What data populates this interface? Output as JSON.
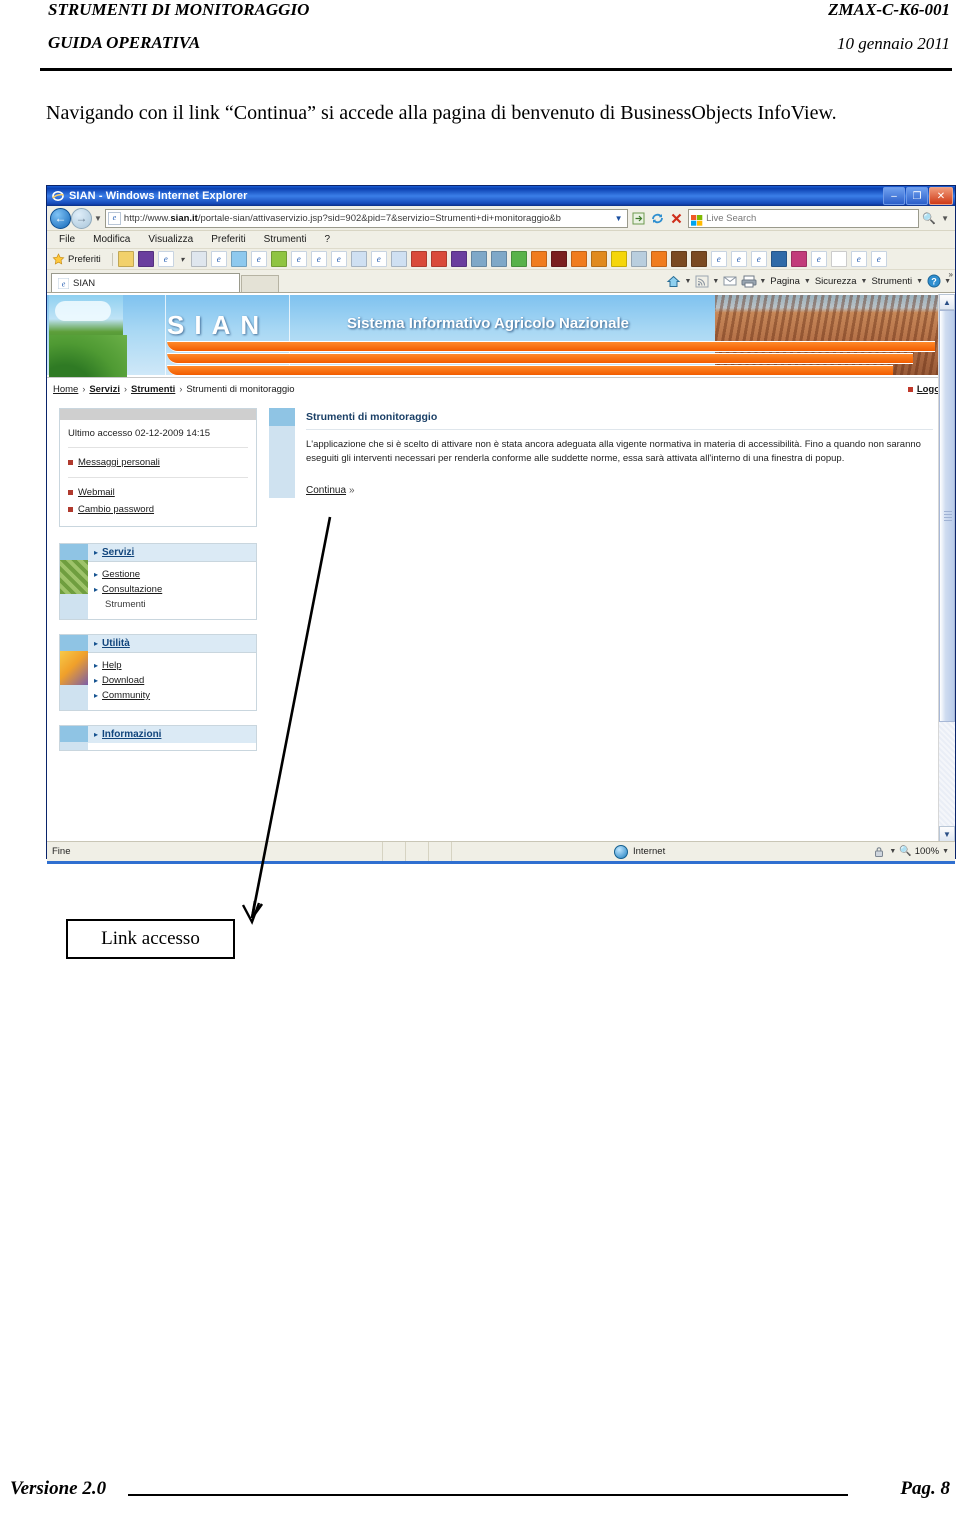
{
  "document": {
    "header": {
      "title": "STRUMENTI DI MONITORAGGIO",
      "subtitle": "GUIDA OPERATIVA",
      "code": "ZMAX-C-K6-001",
      "date": "10 gennaio 2011"
    },
    "intro_paragraph": "Navigando con il link “Continua” si accede alla pagina di benvenuto di BusinessObjects InfoView.",
    "annotation": {
      "label": "Link accesso"
    },
    "footer": {
      "version": "Versione 2.0",
      "page": "Pag. 8"
    }
  },
  "browser": {
    "window_title": "SIAN - Windows Internet Explorer",
    "window_icon": "internet-explorer-icon",
    "controls": {
      "minimize": "–",
      "restore": "❐",
      "close": "✕"
    },
    "address": {
      "url_prefix": "http://www.",
      "url_domain": "sian.it",
      "url_path": "/portale-sian/attivaservizio.jsp?sid=902&pid=7&servizio=Strumenti+di+monitoraggio&b",
      "back_label": "←",
      "forward_label": "→",
      "history_caret": "▼",
      "dropdown_caret": "▼",
      "compat_icon": "compatibility-view-icon",
      "refresh_icon": "refresh-icon",
      "stop_icon": "stop-icon"
    },
    "search": {
      "placeholder": "Live Search",
      "provider_icon": "live-search-icon",
      "go_icon": "search-icon"
    },
    "menu": [
      "File",
      "Modifica",
      "Visualizza",
      "Preferiti",
      "Strumenti",
      "?"
    ],
    "favorites": {
      "label": "Preferiti",
      "star_icon": "star-icon",
      "items": [
        {
          "icon": "star-outline-icon",
          "color": "#f2d16b"
        },
        {
          "icon": "tumblr-icon",
          "color": "#6a3e9e"
        },
        {
          "icon": "ie-page-icon",
          "color": "#ffffff"
        },
        {
          "icon": "chevron-down-icon",
          "color": "#444444"
        },
        {
          "icon": "page-icon",
          "color": "#dfe6ee"
        },
        {
          "icon": "ie-page-icon",
          "color": "#ffffff"
        },
        {
          "icon": "blue-page-icon",
          "color": "#8ec9ee"
        },
        {
          "icon": "ie-page-icon",
          "color": "#ffffff"
        },
        {
          "icon": "windows-icon",
          "color": "#8fc441"
        },
        {
          "icon": "ie-page-icon",
          "color": "#ffffff"
        },
        {
          "icon": "ie-page-icon",
          "color": "#ffffff"
        },
        {
          "icon": "ie-page-icon",
          "color": "#ffffff"
        },
        {
          "icon": "new-page-icon",
          "color": "#cfe0f2"
        },
        {
          "icon": "ie-page-icon",
          "color": "#ffffff"
        },
        {
          "icon": "new-page-icon",
          "color": "#cfe0f2"
        },
        {
          "icon": "alert-page-icon",
          "color": "#d94a3a"
        },
        {
          "icon": "alert-page-icon",
          "color": "#d94a3a"
        },
        {
          "icon": "tumblr-icon",
          "color": "#6a3e9e"
        },
        {
          "icon": "note-icon",
          "color": "#7fa8c8"
        },
        {
          "icon": "note-icon",
          "color": "#7fa8c8"
        },
        {
          "icon": "green-shape-icon",
          "color": "#58b24a"
        },
        {
          "icon": "orange-doc-icon",
          "color": "#f07c1e"
        },
        {
          "icon": "mcafee-icon",
          "color": "#7a1f1f"
        },
        {
          "icon": "orange-doc-icon",
          "color": "#f07c1e"
        },
        {
          "icon": "warning-icon",
          "color": "#e08a1e"
        },
        {
          "icon": "smiley-icon",
          "color": "#f5d60a"
        },
        {
          "icon": "arrow-icon",
          "color": "#b9cede"
        },
        {
          "icon": "orange-doc-icon",
          "color": "#f07c1e"
        },
        {
          "icon": "monkey-icon",
          "color": "#7a4a22"
        },
        {
          "icon": "monkey-icon",
          "color": "#7a4a22"
        },
        {
          "icon": "ie-page-icon",
          "color": "#ffffff"
        },
        {
          "icon": "ie-page-icon",
          "color": "#ffffff"
        },
        {
          "icon": "ie-page-icon",
          "color": "#ffffff"
        },
        {
          "icon": "globe-app-icon",
          "color": "#2f6aa8"
        },
        {
          "icon": "qr-icon",
          "color": "#c23b7a"
        },
        {
          "icon": "ie-page-icon",
          "color": "#ffffff"
        },
        {
          "icon": "letter-a-icon",
          "color": "#ffffff"
        },
        {
          "icon": "ie-page-icon",
          "color": "#ffffff"
        },
        {
          "icon": "ie-page-icon",
          "color": "#ffffff"
        }
      ]
    },
    "tab": {
      "title": "SIAN",
      "icon": "ie-page-icon"
    },
    "command_bar": {
      "home_icon": "home-icon",
      "feeds_icon": "rss-icon",
      "read_mail_icon": "mail-icon",
      "print_icon": "printer-icon",
      "items": [
        "Pagina",
        "Sicurezza",
        "Strumenti"
      ],
      "help_icon": "help-icon",
      "overflow": "»"
    },
    "status_bar": {
      "status_text": "Fine",
      "zone": "Internet",
      "zone_icon": "globe-icon",
      "protected_icon": "lock-icon",
      "zoom": "100%",
      "zoom_icon": "magnifier-icon"
    },
    "scrollbar": {
      "up_arrow": "▲",
      "down_arrow": "▼"
    }
  },
  "page": {
    "banner": {
      "logo": "SIAN",
      "tagline": "Sistema Informativo Agricolo Nazionale",
      "colors": {
        "orange": "#f25c00",
        "sky": "#7fc2ef",
        "field": "#b3724a"
      }
    },
    "breadcrumb": {
      "items": [
        {
          "label": "Home",
          "bold": false
        },
        {
          "label": "Servizi",
          "bold": true
        },
        {
          "label": "Strumenti",
          "bold": true
        }
      ],
      "current": "Strumenti di monitoraggio",
      "separator": "›",
      "logout": "Logout"
    },
    "sidebar": {
      "last_access": "Ultimo accesso 02-12-2009 14:15",
      "links": [
        "Messaggi personali",
        "Webmail",
        "Cambio password"
      ],
      "panels": [
        {
          "title": "Servizi",
          "art": "field-texture",
          "items": [
            {
              "label": "Gestione",
              "link": true
            },
            {
              "label": "Consultazione",
              "link": true
            },
            {
              "label": "Strumenti",
              "link": false
            }
          ]
        },
        {
          "title": "Utilità",
          "art": "tools-texture",
          "items": [
            {
              "label": "Help",
              "link": true
            },
            {
              "label": "Download",
              "link": true
            },
            {
              "label": "Community",
              "link": true
            }
          ]
        },
        {
          "title": "Informazioni",
          "art": "none",
          "items": []
        }
      ]
    },
    "content": {
      "title": "Strumenti di monitoraggio",
      "paragraph": "L'applicazione che si è scelto di attivare non è stata ancora adeguata alla vigente normativa in materia di accessibilità. Fino a quando non saranno eseguiti gli interventi necessari per renderla conforme alle suddette norme, essa sarà attivata all'interno di una finestra di popup.",
      "continue_link": "Continua",
      "continue_marker": "»"
    }
  }
}
